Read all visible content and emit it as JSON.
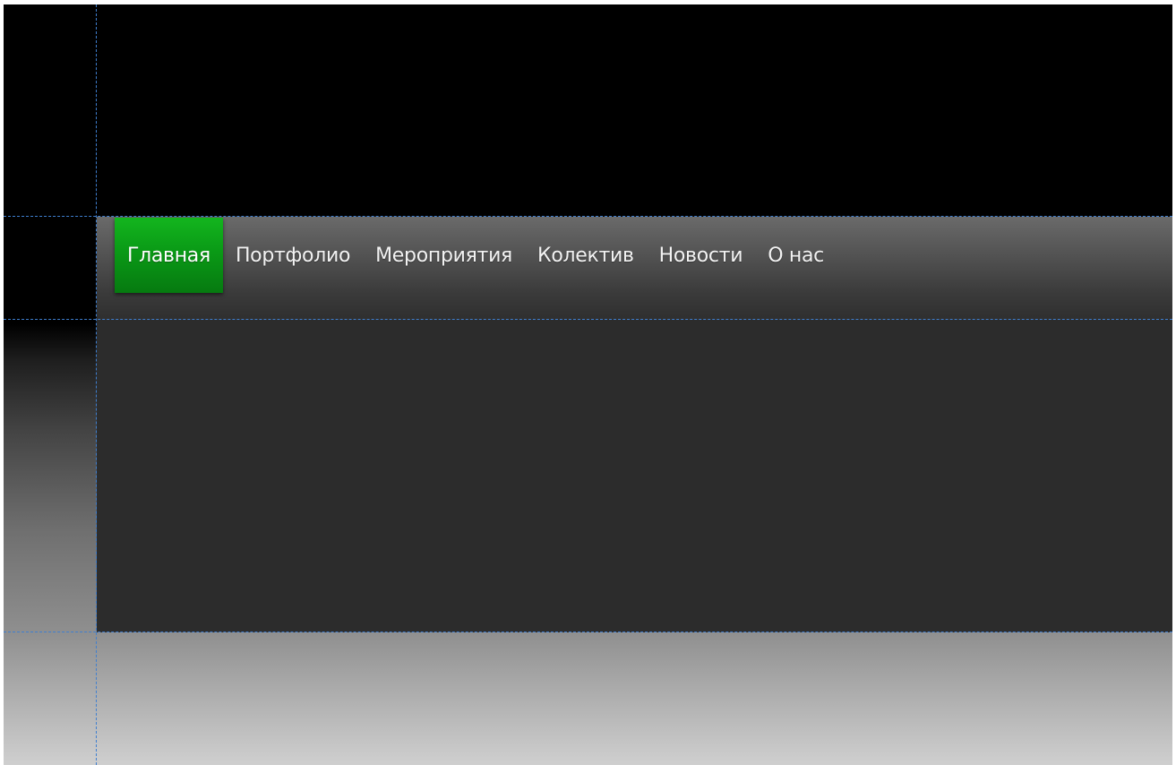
{
  "nav": {
    "items": [
      {
        "label": "Главная",
        "active": true
      },
      {
        "label": "Портфолио",
        "active": false
      },
      {
        "label": "Мероприятия",
        "active": false
      },
      {
        "label": "Колектив",
        "active": false
      },
      {
        "label": "Новости",
        "active": false
      },
      {
        "label": "О нас",
        "active": false
      }
    ]
  },
  "colors": {
    "accent": "#0a9a16",
    "nav_bar": "#545454",
    "content": "#2c2c2c",
    "guide": "#3f7fd0"
  }
}
